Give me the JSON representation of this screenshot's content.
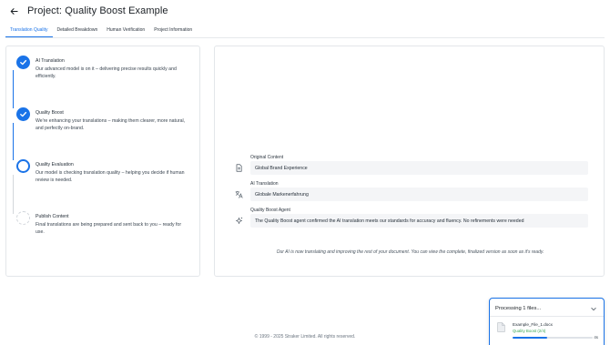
{
  "header": {
    "title": "Project: Quality Boost Example",
    "back_icon": "arrow-left-icon"
  },
  "tabs": [
    {
      "label": "Translation Quality",
      "active": true
    },
    {
      "label": "Detailed Breakdown",
      "active": false
    },
    {
      "label": "Human Verification",
      "active": false
    },
    {
      "label": "Project Information",
      "active": false
    }
  ],
  "steps": [
    {
      "title": "AI Translation",
      "description": "Our advanced model is on it – delivering precise results quickly and efficiently.",
      "status": "done"
    },
    {
      "title": "Quality Boost",
      "description": "We're enhancing your translations – making them clearer, more natural, and perfectly on-brand.",
      "status": "done"
    },
    {
      "title": "Quality Evaluation",
      "description": "Our model is checking translation quality – helping you decide if human review is needed.",
      "status": "in-progress"
    },
    {
      "title": "Publish Content",
      "description": "Final translations are being prepared and sent back to you – ready for use.",
      "status": "pending"
    }
  ],
  "fields": [
    {
      "label": "Original Content",
      "value": "Global Brand Experience",
      "icon": "document-icon"
    },
    {
      "label": "AI Translation",
      "value": "Globale Markenerfahrung",
      "icon": "translate-icon"
    },
    {
      "label": "Quality Boost Agent",
      "value": "The Quality Boost agent confirmed the AI translation meets our standards for accuracy and fluency. No refinements were needed",
      "icon": "sparkle-icon"
    }
  ],
  "status_note": "Our AI is now translating and improving the rest of your document. You can view the complete, finalized version as soon as it's ready.",
  "copyright": "© 1999 - 2025 Straker Limited. All rights reserved.",
  "upload": {
    "title": "Processing 1 files...",
    "file_name": "Example_File_1.docx",
    "file_status": "Quality Boost (2/4)",
    "progress": 0.43,
    "eta": "4s"
  },
  "colors": {
    "accent": "#1a73e8",
    "success_text": "#3aa655"
  }
}
